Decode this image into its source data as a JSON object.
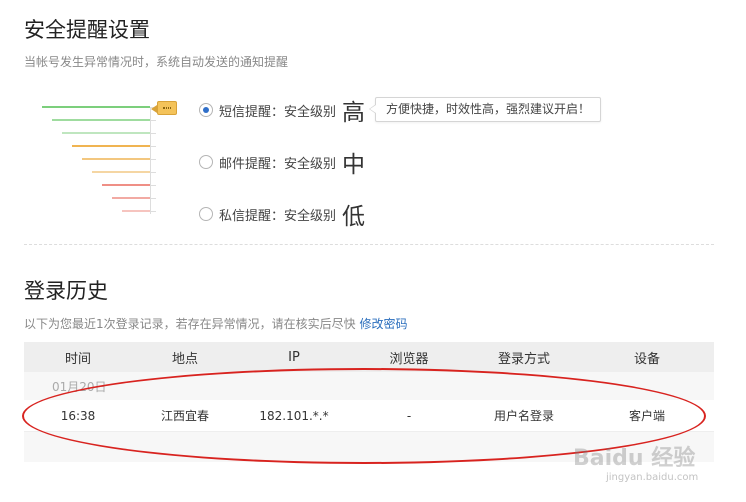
{
  "alert_section": {
    "title": "安全提醒设置",
    "desc": "当帐号发生异常情况时，系统自动发送的通知提醒",
    "options": [
      {
        "label": "短信提醒：安全级别",
        "level": "高",
        "selected": true
      },
      {
        "label": "邮件提醒：安全级别",
        "level": "中",
        "selected": false
      },
      {
        "label": "私信提醒：安全级别",
        "level": "低",
        "selected": false
      }
    ],
    "tip": "方便快捷，时效性高，强烈建议开启！",
    "level_colors": [
      "#7ccf7c",
      "#9fdc9f",
      "#bfe6bf",
      "#f0b451",
      "#f3c77f",
      "#f5d6a3",
      "#ef8f86",
      "#f2aaa3",
      "#f6c4bf"
    ]
  },
  "login_section": {
    "title": "登录历史",
    "desc_prefix": "以下为您最近1次登录记录，若存在异常情况，请在核实后尽快",
    "desc_link": "修改密码",
    "columns": [
      "时间",
      "地点",
      "IP",
      "浏览器",
      "登录方式",
      "设备"
    ],
    "date_group": "01月20日",
    "rows": [
      {
        "time": "16:38",
        "location": "江西宜春",
        "ip": "182.101.*.*",
        "browser": "-",
        "method": "用户名登录",
        "device": "客户端"
      }
    ]
  },
  "watermark": {
    "text": "Baidu 经验",
    "url": "jingyan.baidu.com"
  }
}
